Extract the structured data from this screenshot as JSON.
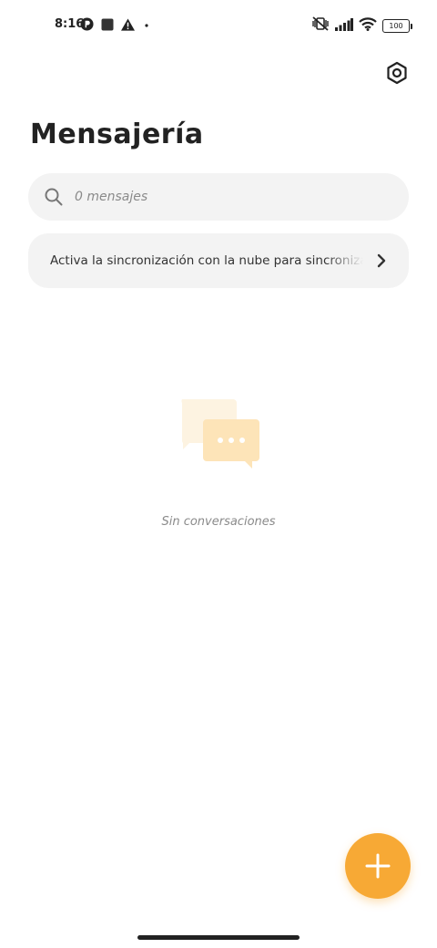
{
  "status_bar": {
    "time": "8:16",
    "battery": "100",
    "icons": [
      "p-circle-icon",
      "square-icon",
      "warning-icon",
      "dot-icon",
      "vibrate-off-icon",
      "signal-icon",
      "wifi-icon",
      "battery-icon"
    ]
  },
  "header": {
    "title": "Mensajería",
    "settings_icon": "settings-hexagon-icon"
  },
  "search": {
    "placeholder": "0 mensajes",
    "icon": "search-icon"
  },
  "sync_banner": {
    "text": "Activa la sincronización con la nube para sincronizar mensajes",
    "icon": "chevron-right-icon"
  },
  "empty_state": {
    "text": "Sin conversaciones",
    "icon": "chat-bubbles-icon"
  },
  "fab": {
    "icon": "plus-icon",
    "color": "#f7a935"
  },
  "colors": {
    "accent": "#f7a935",
    "card_background": "#f3f3f3",
    "muted_text": "#8a8a8a"
  }
}
